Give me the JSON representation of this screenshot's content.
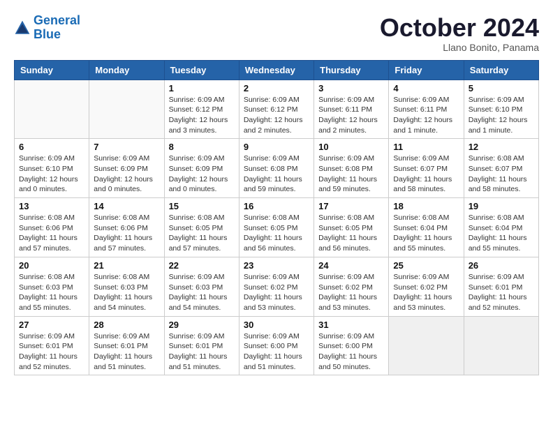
{
  "header": {
    "logo": {
      "line1": "General",
      "line2": "Blue"
    },
    "title": "October 2024",
    "location": "Llano Bonito, Panama"
  },
  "weekdays": [
    "Sunday",
    "Monday",
    "Tuesday",
    "Wednesday",
    "Thursday",
    "Friday",
    "Saturday"
  ],
  "weeks": [
    [
      {
        "day": "",
        "content": "",
        "empty": true
      },
      {
        "day": "",
        "content": "",
        "empty": true
      },
      {
        "day": "1",
        "content": "Sunrise: 6:09 AM\nSunset: 6:12 PM\nDaylight: 12 hours and 3 minutes."
      },
      {
        "day": "2",
        "content": "Sunrise: 6:09 AM\nSunset: 6:12 PM\nDaylight: 12 hours and 2 minutes."
      },
      {
        "day": "3",
        "content": "Sunrise: 6:09 AM\nSunset: 6:11 PM\nDaylight: 12 hours and 2 minutes."
      },
      {
        "day": "4",
        "content": "Sunrise: 6:09 AM\nSunset: 6:11 PM\nDaylight: 12 hours and 1 minute."
      },
      {
        "day": "5",
        "content": "Sunrise: 6:09 AM\nSunset: 6:10 PM\nDaylight: 12 hours and 1 minute."
      }
    ],
    [
      {
        "day": "6",
        "content": "Sunrise: 6:09 AM\nSunset: 6:10 PM\nDaylight: 12 hours and 0 minutes."
      },
      {
        "day": "7",
        "content": "Sunrise: 6:09 AM\nSunset: 6:09 PM\nDaylight: 12 hours and 0 minutes."
      },
      {
        "day": "8",
        "content": "Sunrise: 6:09 AM\nSunset: 6:09 PM\nDaylight: 12 hours and 0 minutes."
      },
      {
        "day": "9",
        "content": "Sunrise: 6:09 AM\nSunset: 6:08 PM\nDaylight: 11 hours and 59 minutes."
      },
      {
        "day": "10",
        "content": "Sunrise: 6:09 AM\nSunset: 6:08 PM\nDaylight: 11 hours and 59 minutes."
      },
      {
        "day": "11",
        "content": "Sunrise: 6:09 AM\nSunset: 6:07 PM\nDaylight: 11 hours and 58 minutes."
      },
      {
        "day": "12",
        "content": "Sunrise: 6:08 AM\nSunset: 6:07 PM\nDaylight: 11 hours and 58 minutes."
      }
    ],
    [
      {
        "day": "13",
        "content": "Sunrise: 6:08 AM\nSunset: 6:06 PM\nDaylight: 11 hours and 57 minutes."
      },
      {
        "day": "14",
        "content": "Sunrise: 6:08 AM\nSunset: 6:06 PM\nDaylight: 11 hours and 57 minutes."
      },
      {
        "day": "15",
        "content": "Sunrise: 6:08 AM\nSunset: 6:05 PM\nDaylight: 11 hours and 57 minutes."
      },
      {
        "day": "16",
        "content": "Sunrise: 6:08 AM\nSunset: 6:05 PM\nDaylight: 11 hours and 56 minutes."
      },
      {
        "day": "17",
        "content": "Sunrise: 6:08 AM\nSunset: 6:05 PM\nDaylight: 11 hours and 56 minutes."
      },
      {
        "day": "18",
        "content": "Sunrise: 6:08 AM\nSunset: 6:04 PM\nDaylight: 11 hours and 55 minutes."
      },
      {
        "day": "19",
        "content": "Sunrise: 6:08 AM\nSunset: 6:04 PM\nDaylight: 11 hours and 55 minutes."
      }
    ],
    [
      {
        "day": "20",
        "content": "Sunrise: 6:08 AM\nSunset: 6:03 PM\nDaylight: 11 hours and 55 minutes."
      },
      {
        "day": "21",
        "content": "Sunrise: 6:08 AM\nSunset: 6:03 PM\nDaylight: 11 hours and 54 minutes."
      },
      {
        "day": "22",
        "content": "Sunrise: 6:09 AM\nSunset: 6:03 PM\nDaylight: 11 hours and 54 minutes."
      },
      {
        "day": "23",
        "content": "Sunrise: 6:09 AM\nSunset: 6:02 PM\nDaylight: 11 hours and 53 minutes."
      },
      {
        "day": "24",
        "content": "Sunrise: 6:09 AM\nSunset: 6:02 PM\nDaylight: 11 hours and 53 minutes."
      },
      {
        "day": "25",
        "content": "Sunrise: 6:09 AM\nSunset: 6:02 PM\nDaylight: 11 hours and 53 minutes."
      },
      {
        "day": "26",
        "content": "Sunrise: 6:09 AM\nSunset: 6:01 PM\nDaylight: 11 hours and 52 minutes."
      }
    ],
    [
      {
        "day": "27",
        "content": "Sunrise: 6:09 AM\nSunset: 6:01 PM\nDaylight: 11 hours and 52 minutes."
      },
      {
        "day": "28",
        "content": "Sunrise: 6:09 AM\nSunset: 6:01 PM\nDaylight: 11 hours and 51 minutes."
      },
      {
        "day": "29",
        "content": "Sunrise: 6:09 AM\nSunset: 6:01 PM\nDaylight: 11 hours and 51 minutes."
      },
      {
        "day": "30",
        "content": "Sunrise: 6:09 AM\nSunset: 6:00 PM\nDaylight: 11 hours and 51 minutes."
      },
      {
        "day": "31",
        "content": "Sunrise: 6:09 AM\nSunset: 6:00 PM\nDaylight: 11 hours and 50 minutes."
      },
      {
        "day": "",
        "content": "",
        "empty": true,
        "shaded": true
      },
      {
        "day": "",
        "content": "",
        "empty": true,
        "shaded": true
      }
    ]
  ]
}
